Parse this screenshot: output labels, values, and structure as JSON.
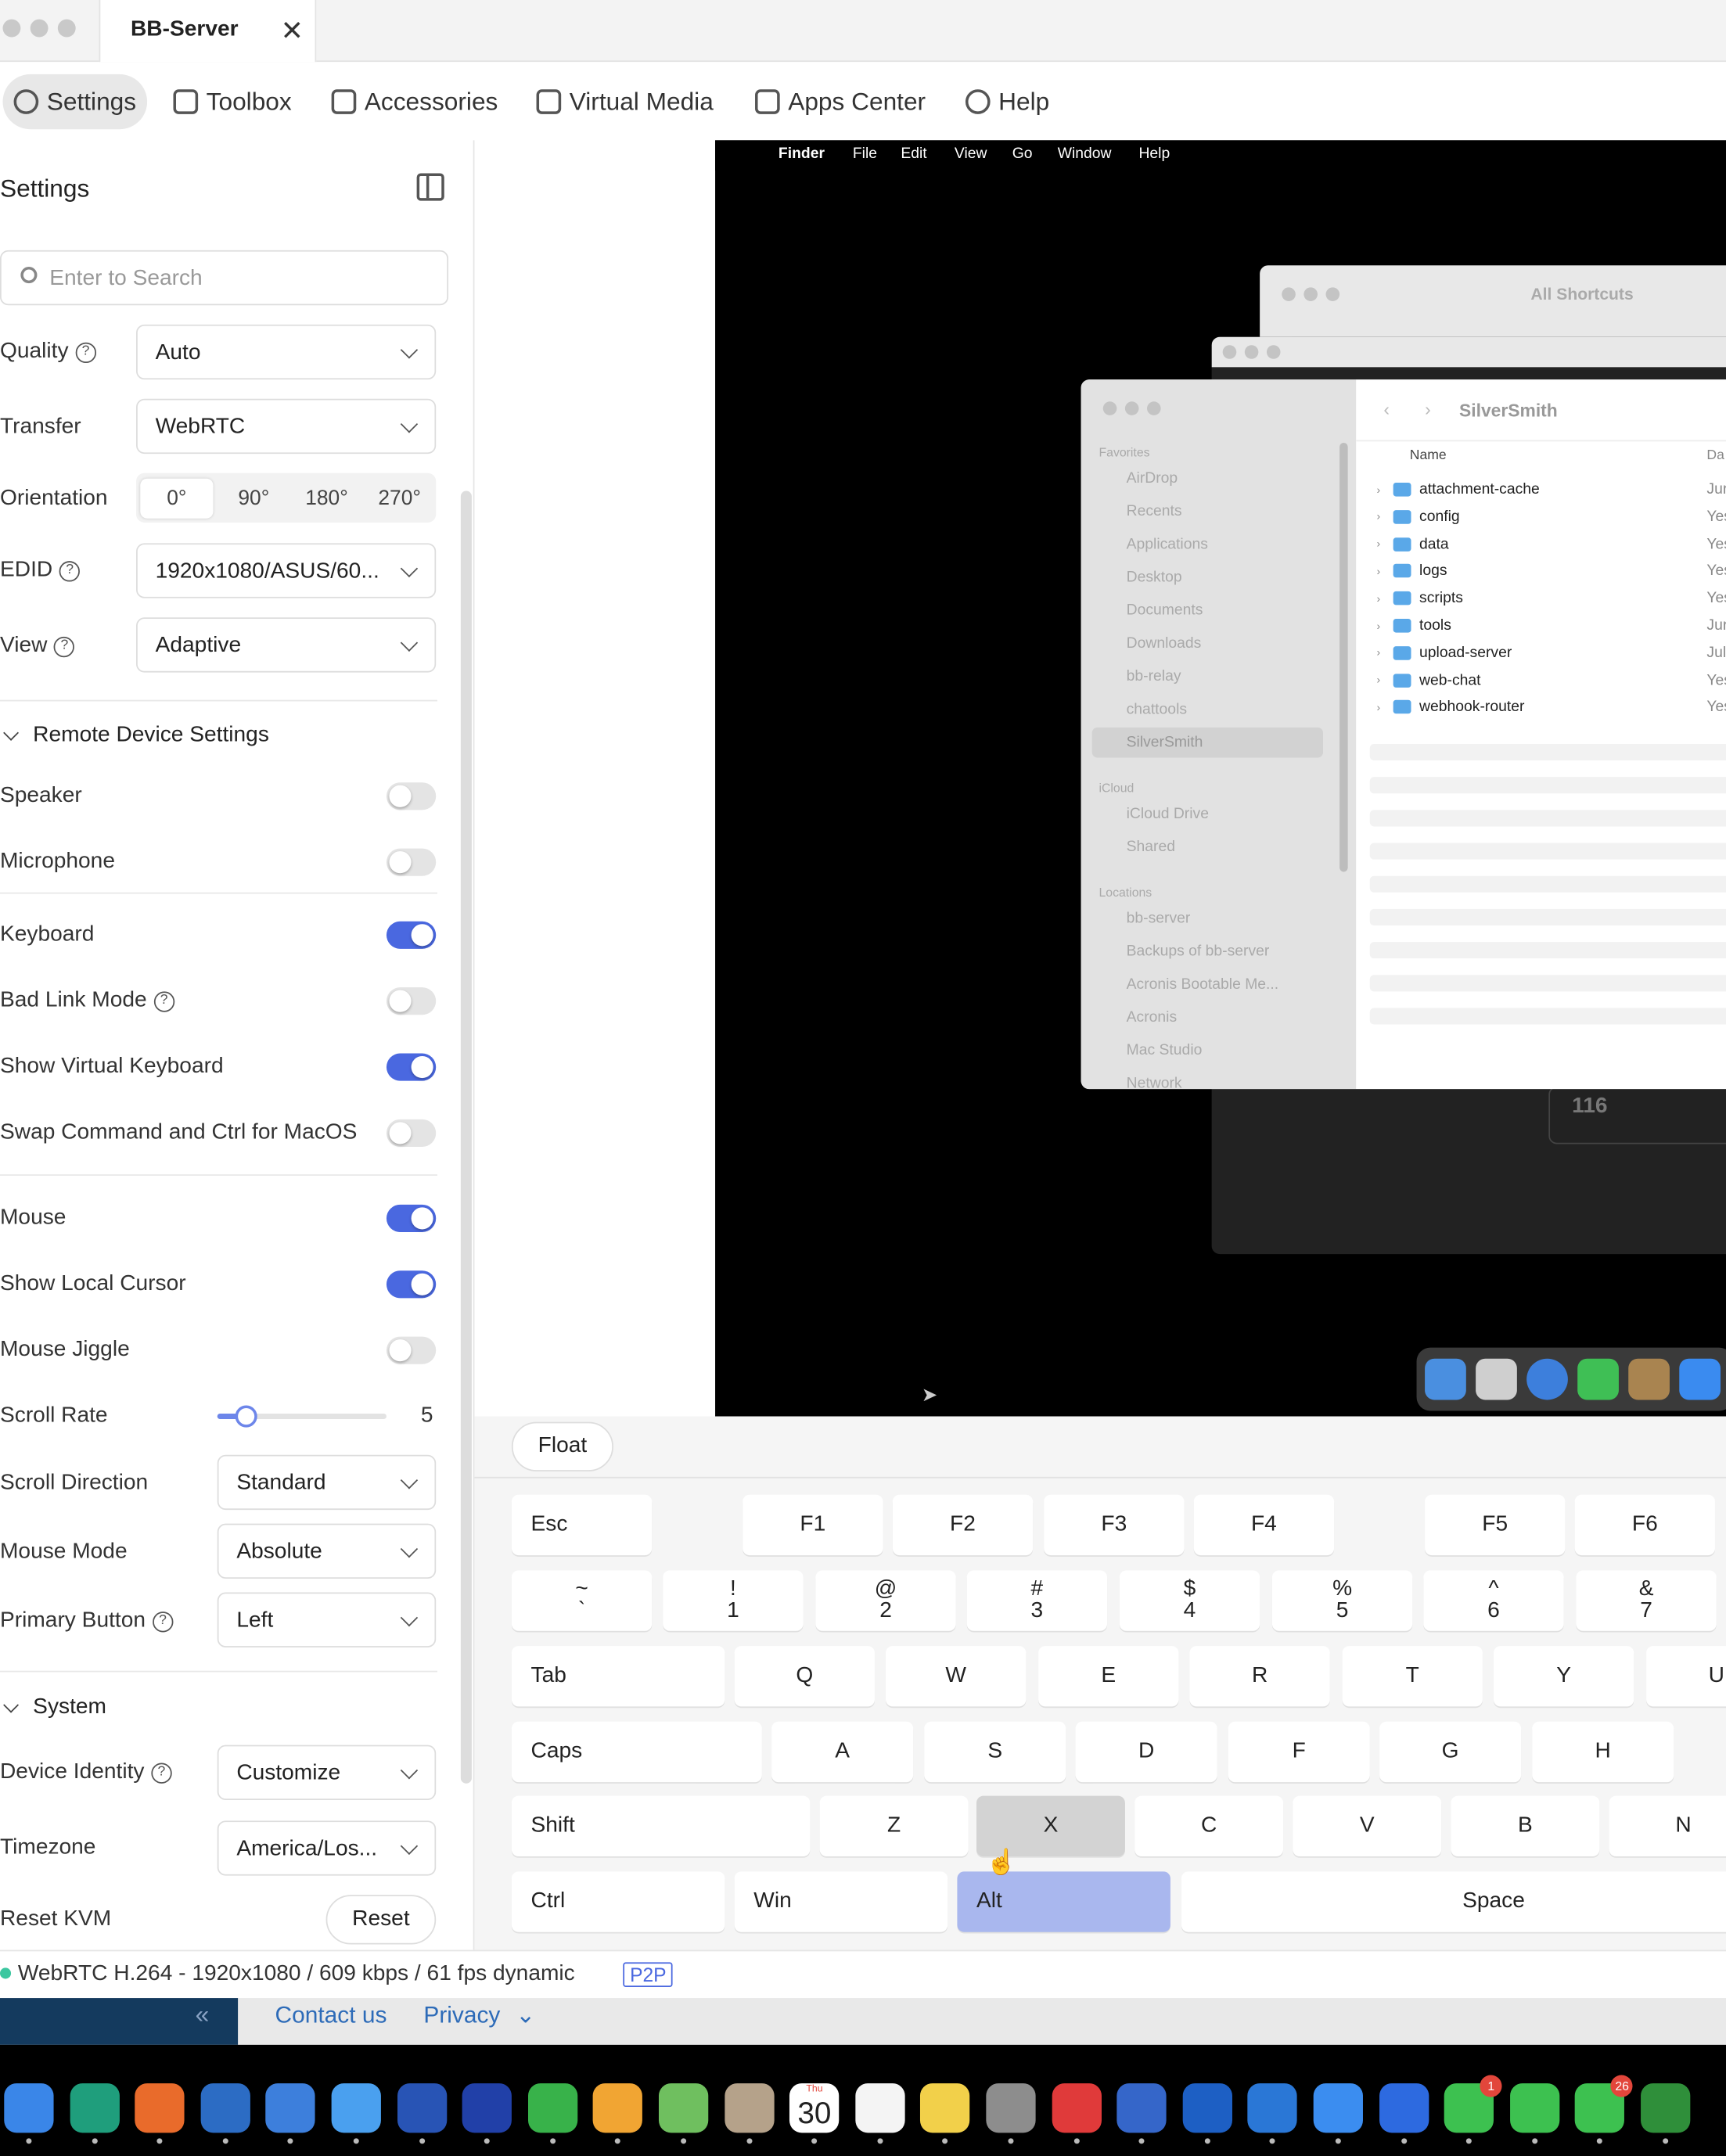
{
  "window": {
    "tab_title": "BB-Server"
  },
  "nav": {
    "items": [
      "Settings",
      "Toolbox",
      "Accessories",
      "Virtual Media",
      "Apps Center",
      "Help"
    ]
  },
  "sidebar": {
    "title": "Settings",
    "search_placeholder": "Enter to Search",
    "quality": {
      "label": "Quality",
      "value": "Auto"
    },
    "transfer": {
      "label": "Transfer",
      "value": "WebRTC"
    },
    "orientation": {
      "label": "Orientation",
      "options": [
        "0°",
        "90°",
        "180°",
        "270°"
      ],
      "selected": "0°"
    },
    "edid": {
      "label": "EDID",
      "value": "1920x1080/ASUS/60..."
    },
    "view": {
      "label": "View",
      "value": "Adaptive"
    },
    "remote_section": "Remote Device Settings",
    "toggles": [
      {
        "label": "Speaker",
        "on": false
      },
      {
        "label": "Microphone",
        "on": false
      },
      {
        "label": "Keyboard",
        "on": true
      },
      {
        "label": "Bad Link Mode",
        "on": false
      },
      {
        "label": "Show Virtual Keyboard",
        "on": true
      },
      {
        "label": "Swap Command and Ctrl for MacOS",
        "on": false
      },
      {
        "label": "Mouse",
        "on": true
      },
      {
        "label": "Show Local Cursor",
        "on": true
      },
      {
        "label": "Mouse Jiggle",
        "on": false
      }
    ],
    "scroll_rate": {
      "label": "Scroll Rate",
      "value": "5",
      "fraction": 0.17
    },
    "scroll_direction": {
      "label": "Scroll Direction",
      "value": "Standard"
    },
    "mouse_mode": {
      "label": "Mouse Mode",
      "value": "Absolute"
    },
    "primary_button": {
      "label": "Primary Button",
      "value": "Left"
    },
    "system_section": "System",
    "device_identity": {
      "label": "Device Identity",
      "value": "Customize"
    },
    "timezone": {
      "label": "Timezone",
      "value": "America/Los..."
    },
    "reset_kvm": {
      "label": "Reset KVM",
      "button": "Reset"
    }
  },
  "remote": {
    "menubar": [
      "Finder",
      "File",
      "Edit",
      "View",
      "Go",
      "Window",
      "Help"
    ],
    "back_window_title": "All Shortcuts",
    "finder_title": "SilverSmith",
    "sidebar_sections": {
      "favorites": "Favorites",
      "favorites_items": [
        "AirDrop",
        "Recents",
        "Applications",
        "Desktop",
        "Documents",
        "Downloads",
        "bb-relay",
        "chattools",
        "SilverSmith"
      ],
      "icloud": "iCloud",
      "icloud_items": [
        "iCloud Drive",
        "Shared"
      ],
      "locations": "Locations",
      "locations_items": [
        "bb-server",
        "Backups of bb-server",
        "Acronis Bootable Me...",
        "Acronis",
        "Mac Studio",
        "Network"
      ]
    },
    "column_name": "Name",
    "column_date": "Da",
    "files": [
      {
        "name": "attachment-cache",
        "date": "Jur"
      },
      {
        "name": "config",
        "date": "Yes"
      },
      {
        "name": "data",
        "date": "Yes"
      },
      {
        "name": "logs",
        "date": "Yes"
      },
      {
        "name": "scripts",
        "date": "Yes"
      },
      {
        "name": "tools",
        "date": "Jur"
      },
      {
        "name": "upload-server",
        "date": "Jul"
      },
      {
        "name": "web-chat",
        "date": "Yes"
      },
      {
        "name": "webhook-router",
        "date": "Yes"
      }
    ],
    "widget_number": "116"
  },
  "keyboard": {
    "float_label": "Float",
    "esc": "Esc",
    "fkeys": [
      "F1",
      "F2",
      "F3",
      "F4",
      "F5",
      "F6"
    ],
    "numrow": [
      [
        "~",
        "`"
      ],
      [
        "!",
        "1"
      ],
      [
        "@",
        "2"
      ],
      [
        "#",
        "3"
      ],
      [
        "$",
        "4"
      ],
      [
        "%",
        "5"
      ],
      [
        "^",
        "6"
      ],
      [
        "&",
        "7"
      ]
    ],
    "tab": "Tab",
    "row1": [
      "Q",
      "W",
      "E",
      "R",
      "T",
      "Y",
      "U"
    ],
    "caps": "Caps",
    "row2": [
      "A",
      "S",
      "D",
      "F",
      "G",
      "H"
    ],
    "shift": "Shift",
    "row3": [
      "Z",
      "X",
      "C",
      "V",
      "B",
      "N"
    ],
    "ctrl": "Ctrl",
    "win": "Win",
    "alt": "Alt",
    "space": "Space"
  },
  "status": {
    "text": "WebRTC H.264 - 1920x1080 / 609 kbps / 61 fps dynamic",
    "badge": "P2P"
  },
  "footer": {
    "contact": "Contact us",
    "privacy": "Privacy"
  },
  "dock": {
    "calendar_month": "Thu",
    "calendar_day": "30",
    "badges": {
      "facetime": "1",
      "messages": "26"
    }
  },
  "colors": {
    "accent": "#4a68e0",
    "status_dot": "#3cc7a0",
    "footer_blue": "#143a5e"
  }
}
